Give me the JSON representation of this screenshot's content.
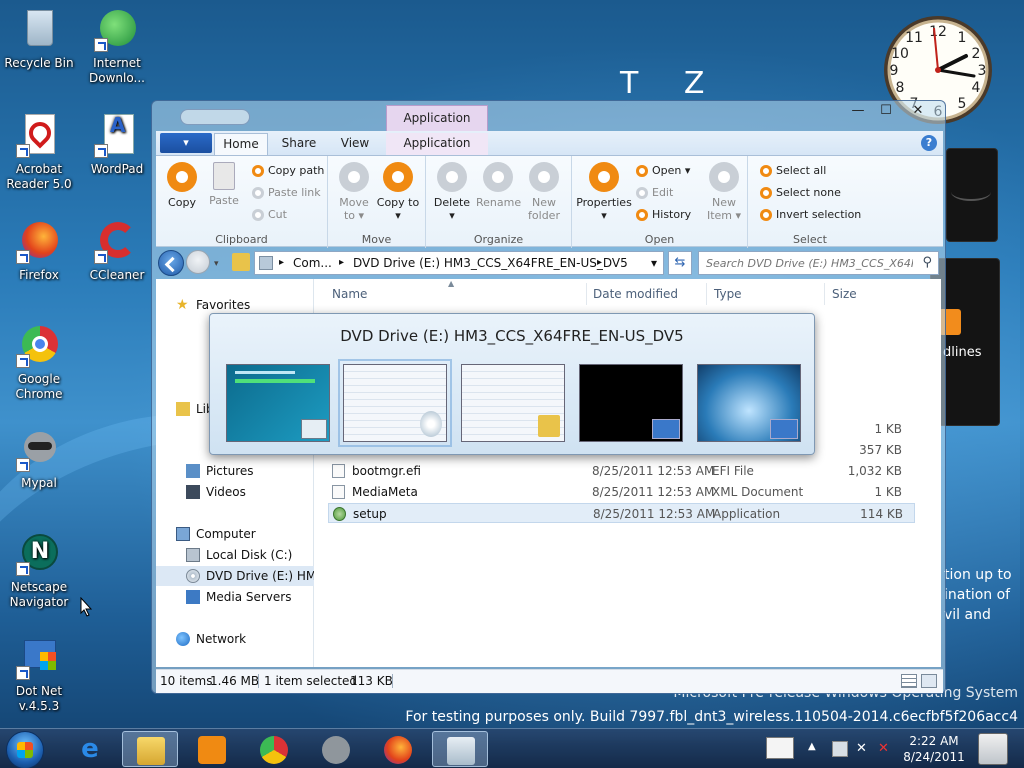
{
  "desktop": {
    "icons": [
      {
        "label": "Recycle Bin"
      },
      {
        "label": "Internet Downlo..."
      },
      {
        "label": "Acrobat Reader 5.0"
      },
      {
        "label": "WordPad"
      },
      {
        "label": "Firefox"
      },
      {
        "label": "CCleaner"
      },
      {
        "label": "Google Chrome"
      },
      {
        "label": "Mypal"
      },
      {
        "label": "Netscape Navigator"
      },
      {
        "label": "Dot Net v.4.5.3"
      }
    ],
    "background_letters": "T Z",
    "gadget_text": "dlines",
    "watermark": {
      "line1": "tion up to",
      "line2": "ination of",
      "line3": "vil and",
      "os": "Microsoft Pre-release Windows Operating System",
      "build": "For testing purposes only. Build 7997.fbl_dnt3_wireless.110504-2014.c6ecfbf5f206acc4"
    }
  },
  "window": {
    "context_tab": "Application Tools",
    "controls": {
      "minimize": "—",
      "maximize": "☐",
      "close": "✕"
    },
    "tabs": {
      "file": "▾",
      "home": "Home",
      "share": "Share",
      "view": "View",
      "application": "Application"
    },
    "help": "?",
    "ribbon": {
      "clipboard": {
        "label": "Clipboard",
        "copy": "Copy",
        "paste": "Paste",
        "copy_path": "Copy path",
        "paste_link": "Paste link",
        "cut": "Cut"
      },
      "move": {
        "label": "Move",
        "move_to": "Move to ▾",
        "copy_to": "Copy to ▾"
      },
      "organize": {
        "label": "Organize",
        "delete": "Delete ▾",
        "rename": "Rename",
        "new_folder": "New folder"
      },
      "open": {
        "label": "Open",
        "properties": "Properties ▾",
        "open": "Open ▾",
        "edit": "Edit",
        "history": "History",
        "new_item": "New Item ▾"
      },
      "select": {
        "label": "Select",
        "select_all": "Select all",
        "select_none": "Select none",
        "invert": "Invert selection"
      }
    },
    "address": {
      "path1": "Com...",
      "path2": "DVD Drive (E:) HM3_CCS_X64FRE_EN-US_DV5",
      "sep": "▸",
      "dropdown": "▾"
    },
    "search": {
      "placeholder": "Search DVD Drive (E:) HM3_CCS_X64F..."
    },
    "nav": {
      "favorites": "Favorites",
      "libraries": "Lib",
      "pictures": "Pictures",
      "videos": "Videos",
      "computer": "Computer",
      "local_disk": "Local Disk (C:)",
      "dvd_drive": "DVD Drive (E:) HM3_",
      "media_servers": "Media Servers",
      "network": "Network"
    },
    "columns": {
      "name": "Name",
      "date": "Date modified",
      "type": "Type",
      "size": "Size"
    },
    "files": [
      {
        "name": "",
        "date": "",
        "type": "",
        "size": "1 KB"
      },
      {
        "name": "",
        "date": "",
        "type": "",
        "size": "357 KB"
      },
      {
        "name": "bootmgr.efi",
        "date": "8/25/2011 12:53 AM",
        "type": "EFI File",
        "size": "1,032 KB"
      },
      {
        "name": "MediaMeta",
        "date": "8/25/2011 12:53 AM",
        "type": "XML Document",
        "size": "1 KB"
      },
      {
        "name": "setup",
        "date": "8/25/2011 12:53 AM",
        "type": "Application",
        "size": "114 KB"
      }
    ],
    "status": {
      "items": "10 items",
      "size": "1.46 MB",
      "selected": "1 item selected",
      "selected_size": "113 KB"
    }
  },
  "thumbnail_popup": {
    "title": "DVD Drive (E:) HM3_CCS_X64FRE_EN-US_DV5"
  },
  "taskbar": {
    "time": "2:22 AM",
    "date": "8/24/2011"
  }
}
